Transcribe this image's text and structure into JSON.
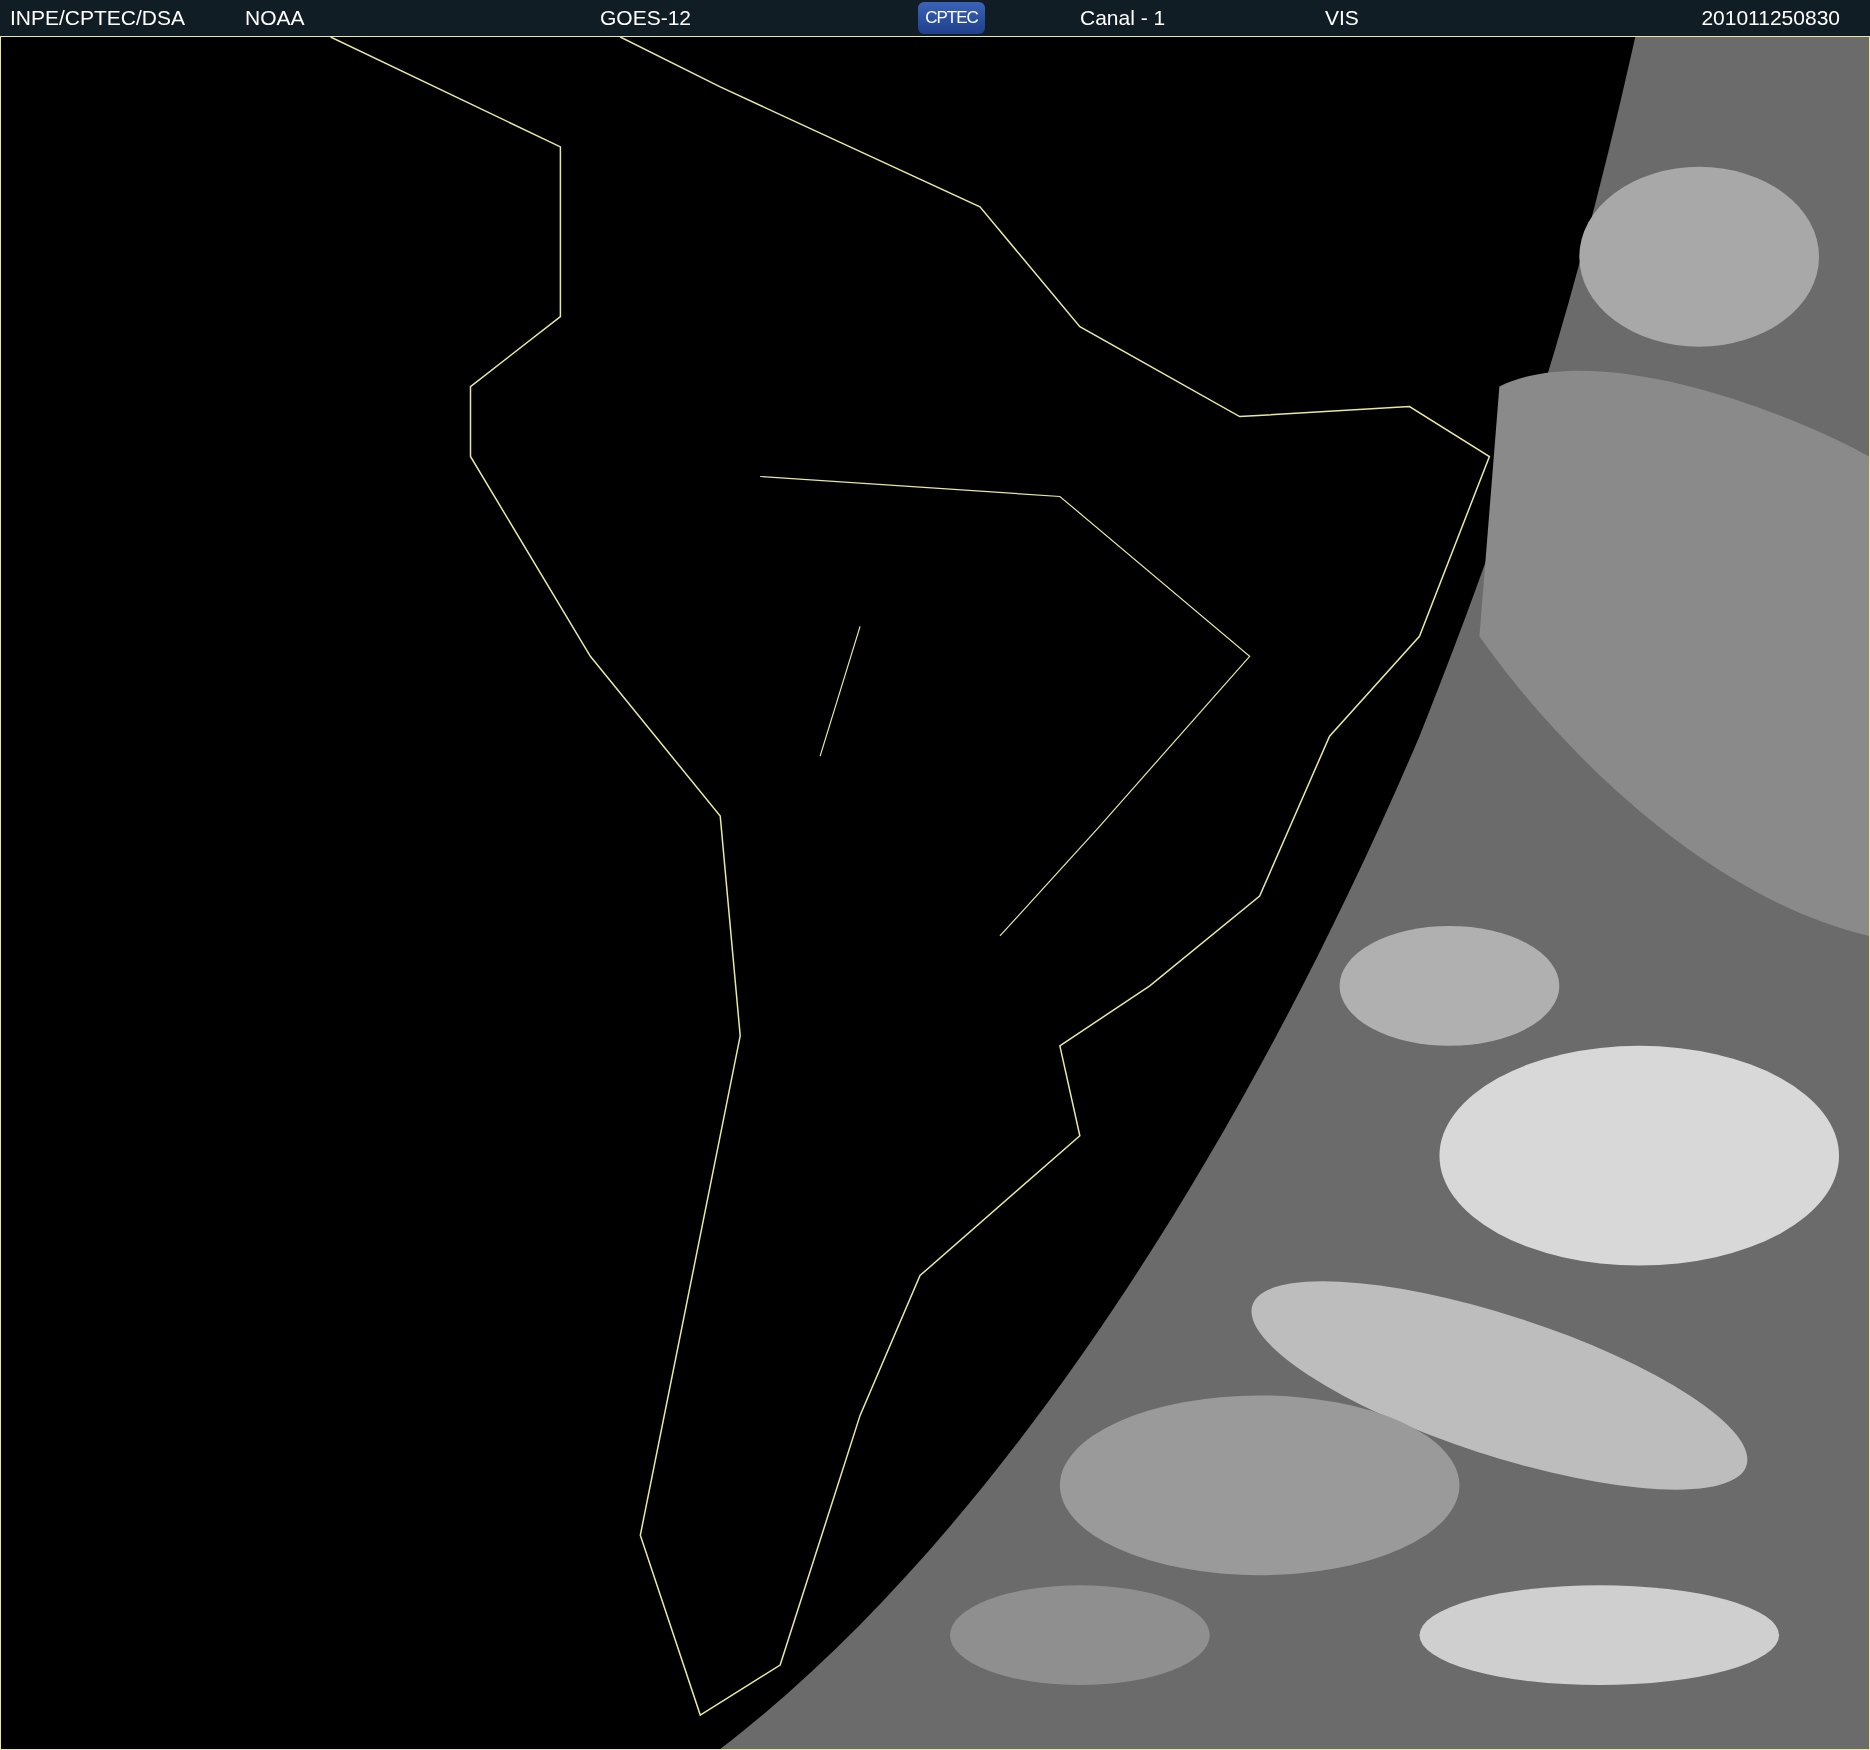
{
  "header": {
    "items": [
      {
        "kind": "text",
        "text": "INPE/CPTEC/DSA"
      },
      {
        "kind": "text",
        "text": "NOAA"
      },
      {
        "kind": "text",
        "text": "GOES-12"
      },
      {
        "kind": "logo",
        "text": "CPTEC"
      },
      {
        "kind": "text",
        "text": "Canal - 1"
      },
      {
        "kind": "text",
        "text": "VIS"
      },
      {
        "kind": "text",
        "text": "201011250830"
      }
    ]
  }
}
